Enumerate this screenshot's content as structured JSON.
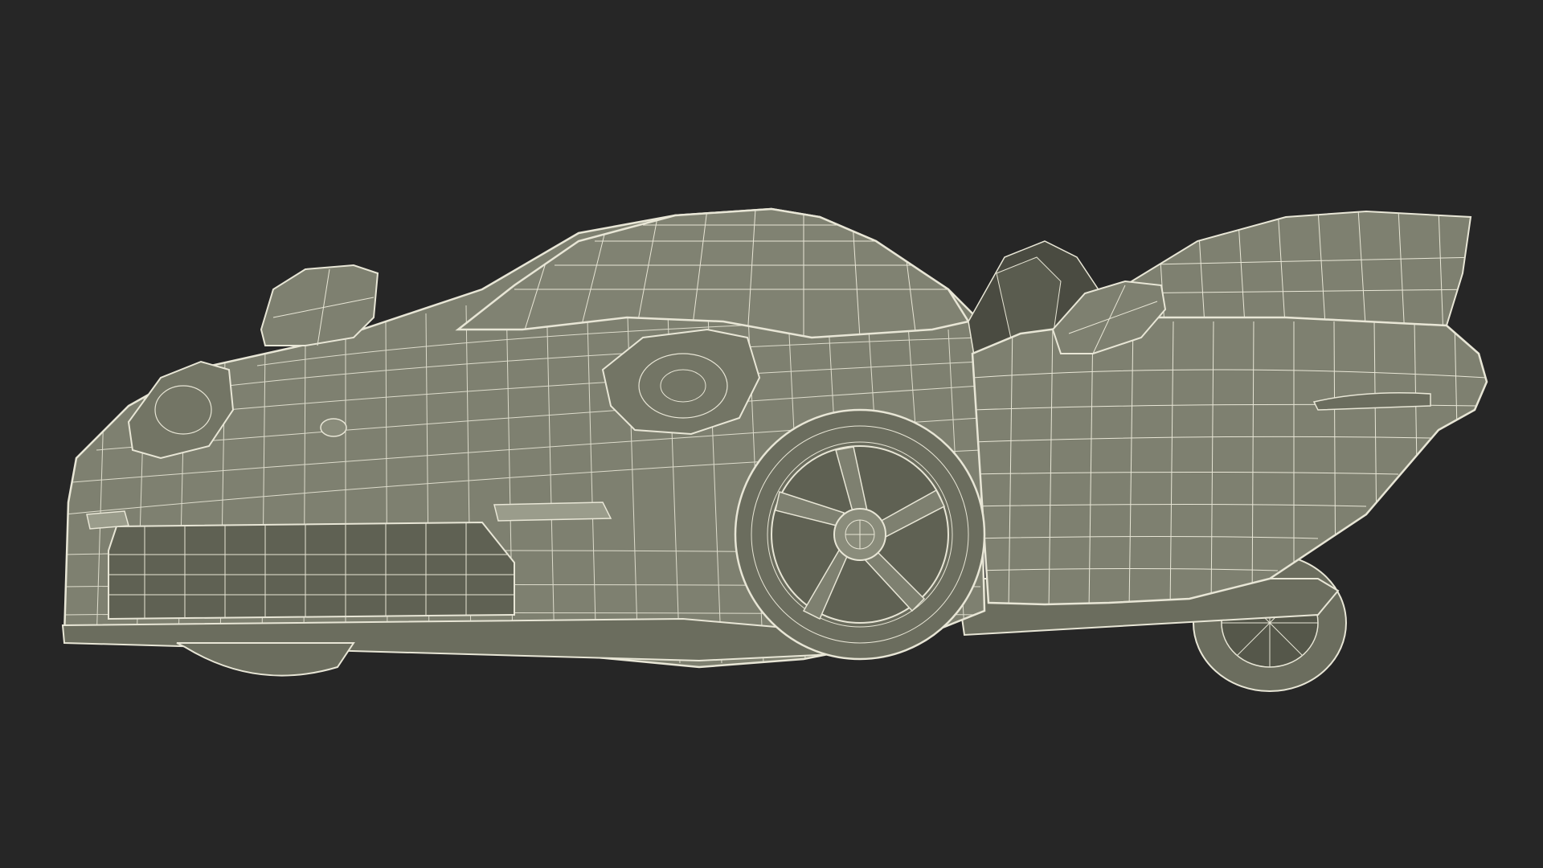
{
  "scene": {
    "subject": "car-wireframe-render",
    "colors": {
      "background": "#262626",
      "surface": "#7e8070",
      "surface_dark": "#6b6d5e",
      "surface_shadow": "#55574a",
      "interior": "#4a4b41",
      "wire": "#e8e6d6"
    },
    "view": "front-three-quarter-low",
    "doors_open": true
  }
}
